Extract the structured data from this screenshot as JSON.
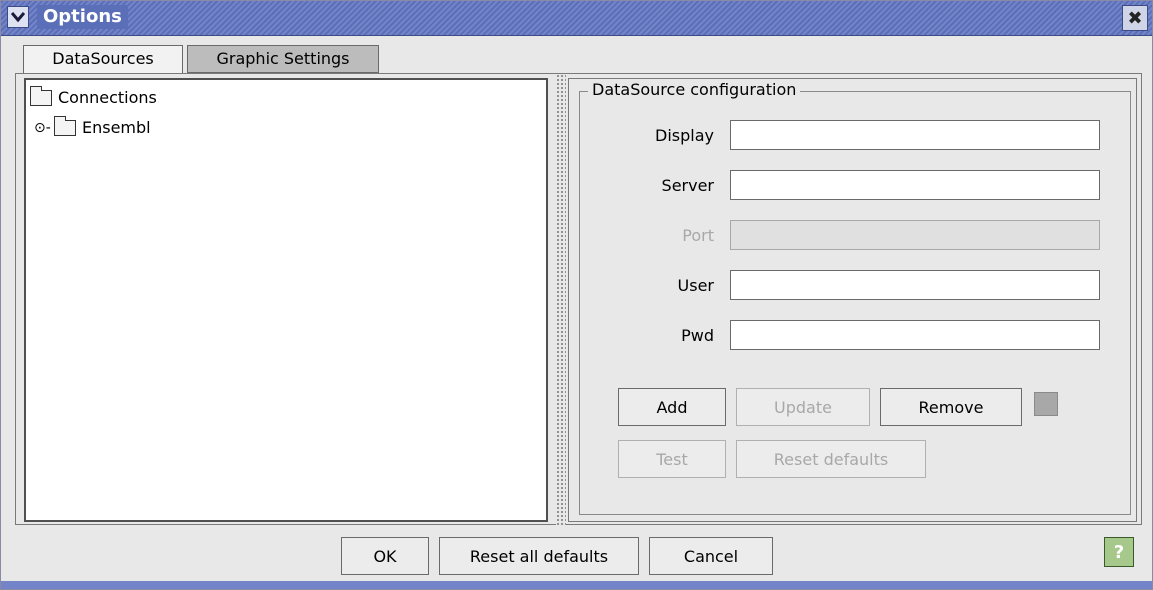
{
  "window": {
    "title": "Options",
    "close_glyph": "✖",
    "menu_glyph": "⌄"
  },
  "tabs": [
    {
      "label": "DataSources",
      "active": true
    },
    {
      "label": "Graphic Settings",
      "active": false
    }
  ],
  "tree": {
    "root": {
      "label": "Connections",
      "icon": "folder-icon"
    },
    "children": [
      {
        "label": "Ensembl",
        "icon": "folder-icon",
        "expander": "⊙-"
      }
    ]
  },
  "config": {
    "group_title": "DataSource configuration",
    "fields": [
      {
        "label": "Display",
        "value": "",
        "enabled": true
      },
      {
        "label": "Server",
        "value": "",
        "enabled": true
      },
      {
        "label": "Port",
        "value": "",
        "enabled": false
      },
      {
        "label": "User",
        "value": "",
        "enabled": true
      },
      {
        "label": "Pwd",
        "value": "",
        "enabled": true
      }
    ],
    "buttons": {
      "add": "Add",
      "update": "Update",
      "remove": "Remove",
      "test": "Test",
      "reset_defaults": "Reset defaults"
    }
  },
  "footer": {
    "ok": "OK",
    "reset_all": "Reset all defaults",
    "cancel": "Cancel",
    "help_glyph": "?"
  },
  "colors": {
    "titlebar": "#5b6fb8",
    "window_bg": "#e8e8e8",
    "help_icon": "#a6c88a"
  }
}
